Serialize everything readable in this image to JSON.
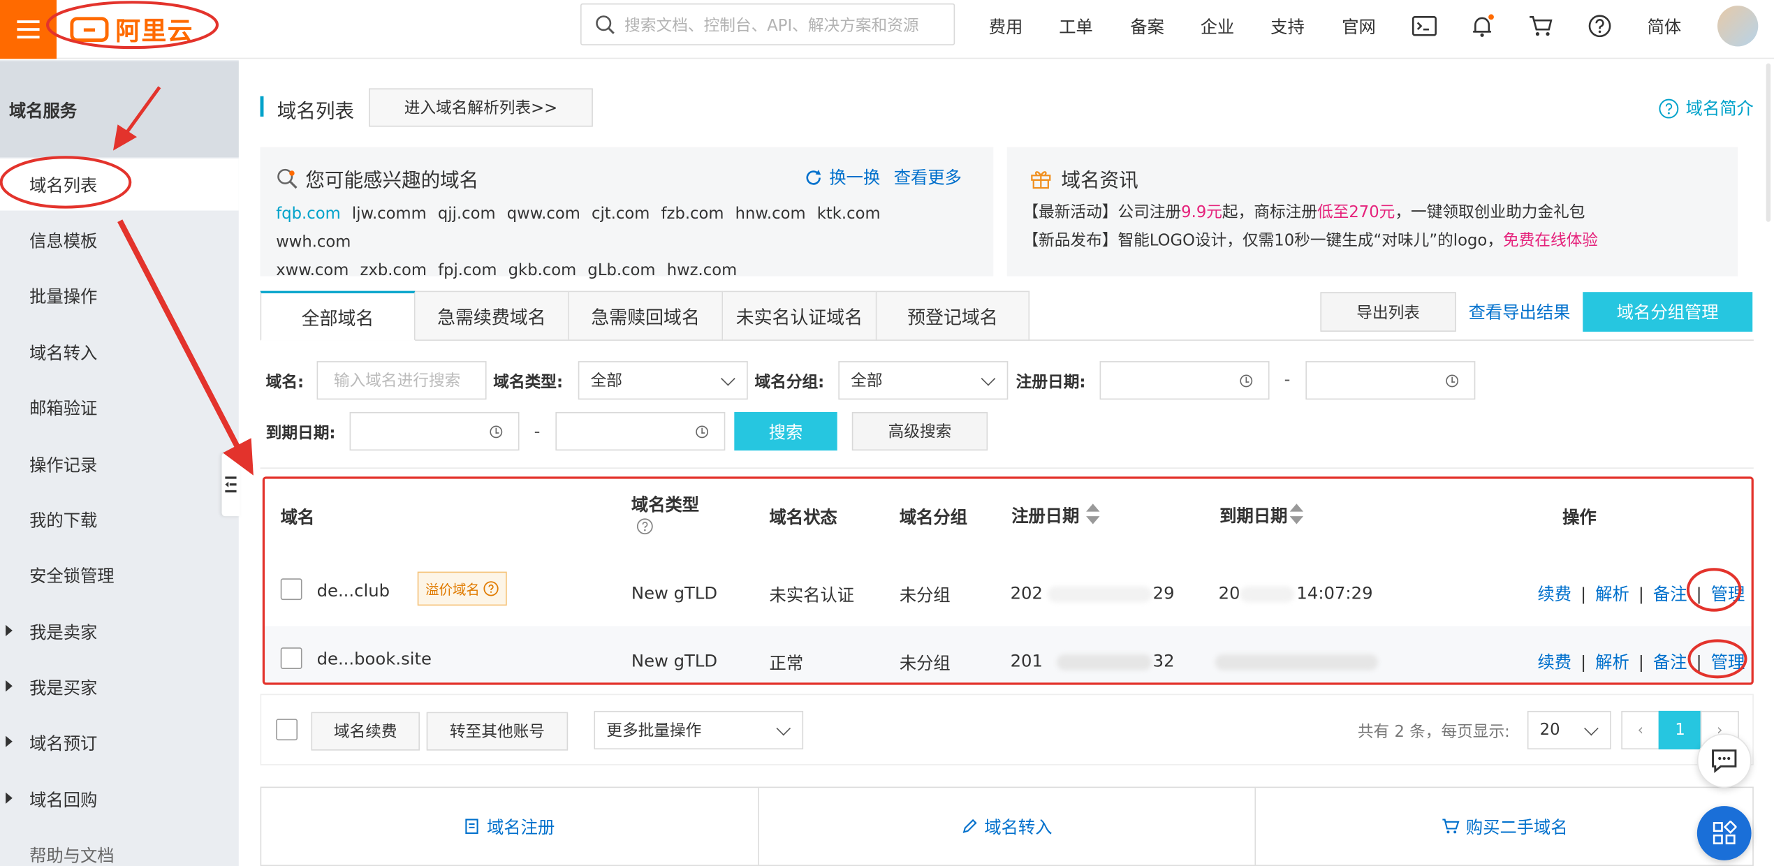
{
  "header": {
    "logo_text": "阿里云",
    "search_placeholder": "搜索文档、控制台、API、解决方案和资源",
    "nav": [
      "费用",
      "工单",
      "备案",
      "企业",
      "支持",
      "官网"
    ],
    "lang": "简体"
  },
  "sidebar": {
    "title": "域名服务",
    "items": [
      {
        "label": "域名列表"
      },
      {
        "label": "信息模板"
      },
      {
        "label": "批量操作"
      },
      {
        "label": "域名转入"
      },
      {
        "label": "邮箱验证"
      },
      {
        "label": "操作记录"
      },
      {
        "label": "我的下载"
      },
      {
        "label": "安全锁管理"
      },
      {
        "label": "我是卖家"
      },
      {
        "label": "我是买家"
      },
      {
        "label": "域名预订"
      },
      {
        "label": "域名回购"
      },
      {
        "label": "帮助与文档"
      }
    ]
  },
  "page": {
    "title": "域名列表",
    "resolve_button": "进入域名解析列表>>",
    "help_link": "域名简介"
  },
  "suggest": {
    "title": "您可能感兴趣的域名",
    "refresh": "换一换",
    "more": "查看更多",
    "domains": [
      "fqb.com",
      "ljw.comm",
      "qjj.com",
      "qww.com",
      "cjt.com",
      "fzb.com",
      "hnw.com",
      "ktk.com",
      "wwh.com",
      "xww.com",
      "zxb.com",
      "fpj.com",
      "gkb.com",
      "gLb.com",
      "hwz.com"
    ]
  },
  "news": {
    "title": "域名资讯",
    "line1": {
      "a": "【最新活动】公司注册",
      "b": "9.9元",
      "c": "起，商标注册",
      "d": "低至270元",
      "e": "，一键领取创业助力金礼包"
    },
    "line2": {
      "a": "【新品发布】智能LOGO设计，仅需10秒一键生成“对味儿”的logo，",
      "b": "免费在线体验"
    }
  },
  "tabs": [
    "全部域名",
    "急需续费域名",
    "急需赎回域名",
    "未实名认证域名",
    "预登记域名"
  ],
  "actions": {
    "export": "导出列表",
    "export_result": "查看导出结果",
    "group_manage": "域名分组管理"
  },
  "filters": {
    "domain_label": "域名:",
    "domain_placeholder": "输入域名进行搜索",
    "type_label": "域名类型:",
    "type_value": "全部",
    "group_label": "域名分组:",
    "group_value": "全部",
    "reg_label": "注册日期:",
    "exp_label": "到期日期:",
    "dash": "-",
    "search": "搜索",
    "advanced": "高级搜索"
  },
  "table": {
    "columns": [
      "域名",
      "域名类型",
      "域名状态",
      "域名分组",
      "注册日期",
      "到期日期",
      "操作"
    ],
    "rows": [
      {
        "domain": "de...club",
        "premium_badge": "溢价域名",
        "type": "New gTLD",
        "status": "未实名认证",
        "group": "未分组",
        "reg": "202",
        "reg_tail": "29",
        "exp": "20",
        "exp_tail": "14:07:29"
      },
      {
        "domain": "de...book.site",
        "type": "New gTLD",
        "status": "正常",
        "group": "未分组",
        "reg": "201",
        "reg_tail": "32",
        "exp": "",
        "exp_tail": ""
      }
    ],
    "ops": [
      "续费",
      "解析",
      "备注",
      "管理"
    ]
  },
  "bulk": {
    "renew": "域名续费",
    "transfer": "转至其他账号",
    "more": "更多批量操作",
    "summary": "共有 2 条，每页显示:",
    "page_size": "20",
    "prev": "‹",
    "current_page": "1",
    "next": "›"
  },
  "quick_links": [
    "域名注册",
    "域名转入",
    "购买二手域名"
  ],
  "colors": {
    "accent": "#00a2ca",
    "brand": "#ff6a00",
    "primary_button": "#26c6e0",
    "link": "#0070cc",
    "annotation": "#e3332c"
  }
}
